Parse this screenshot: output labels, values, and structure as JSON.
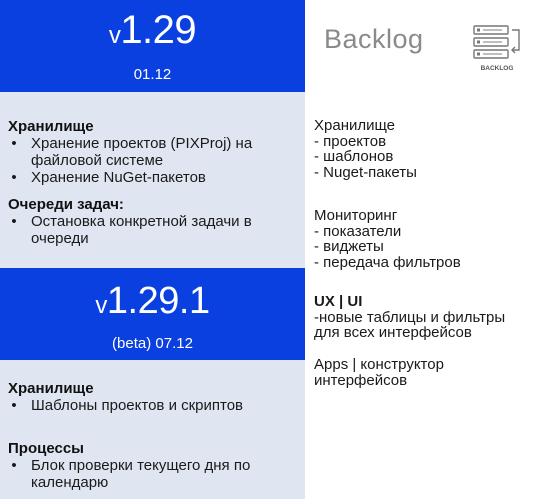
{
  "release_1": {
    "version": "v1.29",
    "date": "01.12",
    "sections": [
      {
        "heading": "Хранилище",
        "items": [
          "Хранение проектов (PIXProj) на файловой системе",
          "Хранение NuGet-пакетов"
        ]
      },
      {
        "heading": "Очереди задач:",
        "items": [
          "Остановка конкретной задачи в очереди"
        ]
      }
    ]
  },
  "release_2": {
    "version": "v1.29.1",
    "date": "(beta) 07.12",
    "sections": [
      {
        "heading": "Хранилище",
        "items": [
          "Шаблоны проектов и скриптов"
        ]
      },
      {
        "heading": "Процессы",
        "items": [
          "Блок проверки текущего дня по календарю"
        ]
      }
    ]
  },
  "backlog": {
    "title": "Backlog",
    "icon_label": "BACKLOG",
    "groups": [
      {
        "lines": [
          "Хранилище",
          "- проектов",
          "- шаблонов",
          "- Nuget-пакеты"
        ]
      },
      {
        "lines": [
          "Мониторинг",
          "- показатели",
          "- виджеты",
          "- передача фильтров"
        ]
      },
      {
        "title": "UX | UI",
        "lines": [
          "-новые таблицы и фильтры",
          "для всех интерфейсов"
        ]
      },
      {
        "lines": [
          "Apps | конструктор",
          "интерфейсов"
        ]
      }
    ]
  },
  "bullet_char": "•",
  "colors": {
    "banner_blue": "#0a3fe0",
    "panel_bg": "#dfe6f2",
    "backlog_gray": "#8a8a8a"
  }
}
